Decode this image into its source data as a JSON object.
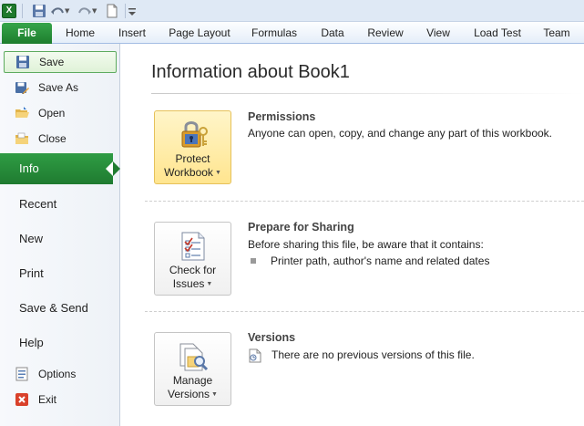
{
  "qat": {
    "app_icon": "excel-icon",
    "icons": [
      "save-icon",
      "undo-icon",
      "redo-icon",
      "new-document-icon",
      "customize-toolbar-icon"
    ]
  },
  "ribbon": {
    "file_tab": "File",
    "tabs": [
      "Home",
      "Insert",
      "Page Layout",
      "Formulas",
      "Data",
      "Review",
      "View",
      "Load Test",
      "Team"
    ]
  },
  "nav": {
    "commands_top": [
      {
        "label": "Save",
        "icon": "save-icon",
        "selected": true
      },
      {
        "label": "Save As",
        "icon": "save-as-icon"
      },
      {
        "label": "Open",
        "icon": "open-folder-icon"
      },
      {
        "label": "Close",
        "icon": "close-folder-icon"
      }
    ],
    "tabs": [
      {
        "label": "Info",
        "active": true
      },
      {
        "label": "Recent"
      },
      {
        "label": "New"
      },
      {
        "label": "Print"
      },
      {
        "label": "Save & Send"
      },
      {
        "label": "Help"
      }
    ],
    "commands_bottom": [
      {
        "label": "Options",
        "icon": "options-icon"
      },
      {
        "label": "Exit",
        "icon": "exit-icon"
      }
    ]
  },
  "main": {
    "title": "Information about Book1",
    "sections": [
      {
        "button_line1": "Protect",
        "button_line2": "Workbook",
        "heading": "Permissions",
        "text": "Anyone can open, copy, and change any part of this workbook."
      },
      {
        "button_line1": "Check for",
        "button_line2": "Issues",
        "heading": "Prepare for Sharing",
        "text": "Before sharing this file, be aware that it contains:",
        "bullet": "Printer path, author's name and related dates"
      },
      {
        "button_line1": "Manage",
        "button_line2": "Versions",
        "heading": "Versions",
        "text": "There are no previous versions of this file."
      }
    ]
  },
  "colors": {
    "accent_green": "#1f7b30",
    "highlight_yellow": "#ffe58f",
    "ribbon_blue": "#dfe9f5"
  }
}
